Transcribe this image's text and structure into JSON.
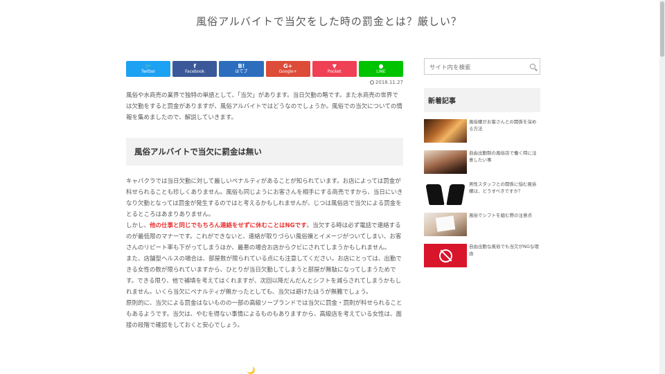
{
  "site": {
    "title": "風俗アルバイトで当欠をした時の罰金とは？厳しい？"
  },
  "share_buttons": [
    {
      "icon": "🐦",
      "label": "Twitter",
      "color": "#1da1f2"
    },
    {
      "icon": "f",
      "label": "Facebook",
      "color": "#3b5998"
    },
    {
      "icon": "B!",
      "label": "はてブ",
      "color": "#2c6ebd"
    },
    {
      "icon": "G+",
      "label": "Google+",
      "color": "#dd4b39"
    },
    {
      "icon": "▼",
      "label": "Pocket",
      "color": "#ef4056"
    },
    {
      "icon": "●",
      "label": "LINE",
      "color": "#00c300"
    }
  ],
  "post": {
    "date": "2018.11.27",
    "intro": "風俗や水商売の業界で独特の単語として、「当欠」があります。当日欠勤の略です。また水商売の世界では欠勤をすると罰金がありますが、風俗アルバイトではどうなのでしょうか。風俗での当欠についての情報を集めましたので、解説していきます。",
    "heading": "風俗アルバイトで当欠に罰金は無い",
    "para1": "キャバクラでは当日欠勤に対して厳しいペナルティがあることが知られています。お店によっては罰金が科せられることも珍しくありません。風俗も同じようにお客さんを相手にする商売ですから、当日にいきなり欠勤となっては罰金が発生するのではと考えるかもしれませんが、じつは風俗店で当欠による罰金をとるところはあまりありません。",
    "para2_prefix": "しかし、",
    "para2_emphasis": "他の仕事と同じでもちろん連絡をせずに休むことはNGです",
    "para2_suffix": "。当欠する時は必ず電話で連絡するのが最低限のマナーです。これができないと、連絡が取りづらい風俗嬢とイメージがついてしまい、お客さんのリピート率も下がってしまうほか、最悪の場合お店からクビにされてしまうかもしれません。",
    "para3": "また、店舗型ヘルスの場合は、部屋数が限られている点にも注意してください。お店にとっては、出勤できる女性の数が限られていますから、ひとりが当日欠勤してしまうと部屋が無駄になってしまうためです。できる限り、他で補填を考えてはくれますが、次回以降だんだんとシフトを減らされてしまうかもしれません。いくら当欠にペナルティが無かったとしても、当欠は避けたほうが無難でしょう。",
    "para4": "原則的に、当欠による罰金はないものの一部の高級ソープランドでは当欠に罰金・罰則が科せられることもあるようです。当欠は、やむを得ない事情によるものもありますから、高級店を考えている女性は、面接の段階で確認をしておくと安心でしょう。",
    "trailing_icon": "🌙"
  },
  "sidebar": {
    "search_placeholder": "サイト内を検索",
    "widget_title": "新着記事",
    "recent": [
      {
        "title": "風俗嬢がお客さんとの関係を深める方法"
      },
      {
        "title": "自由出勤制の風俗店で働く時に注意したい事"
      },
      {
        "title": "男性スタッフとの関係に悩む風俗嬢は、どうすべきですか？"
      },
      {
        "title": "風俗でシフトを組む際の注意点"
      },
      {
        "title": "自由出勤な風俗でも当欠がNGな理由"
      }
    ]
  }
}
